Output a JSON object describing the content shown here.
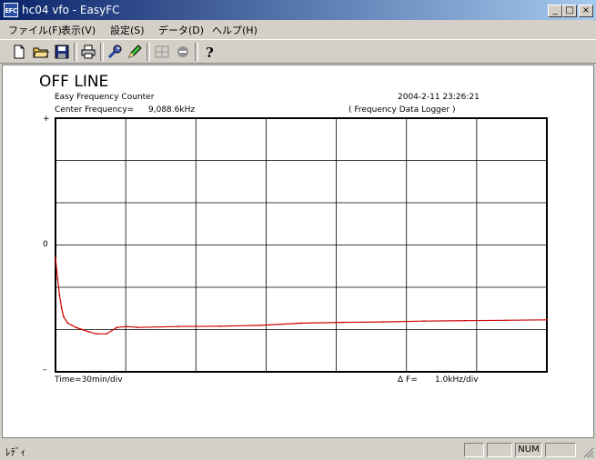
{
  "window": {
    "app_icon_text": "EFC",
    "title": "hc04 vfo - EasyFC",
    "minimize": "_",
    "maximize": "□",
    "close": "×"
  },
  "menu": [
    "ファイル(F)",
    "表示(V)",
    "設定(S)",
    "データ(D)",
    "ヘルプ(H)"
  ],
  "toolbar": {
    "icons": [
      "new-file-icon",
      "open-folder-icon",
      "save-disk-icon",
      "print-icon",
      "wrench-icon",
      "pencil-icon",
      "grid-icon",
      "stop-icon",
      "help-icon"
    ]
  },
  "display": {
    "status_title": "OFF LINE",
    "app_name": "Easy Frequency Counter",
    "timestamp": "2004-2-11  23:26:21",
    "center_freq_label": "Center Frequency=",
    "center_freq_value": "9,088.6kHz",
    "mode_label": "( Frequency Data Logger )",
    "y_top": "+",
    "y_mid": "0",
    "y_bottom": "–",
    "time_scale": "Time=30min/div",
    "delta_label": "Δ F=",
    "delta_value": "1.0kHz/div"
  },
  "chart_data": {
    "type": "line",
    "x_unit": "min",
    "y_unit": "kHz (offset from center)",
    "xlim": [
      0,
      240
    ],
    "ylim": [
      -3,
      3
    ],
    "grid": true,
    "series": [
      {
        "color": "#cc0000",
        "x": [
          0,
          1,
          2,
          3,
          4,
          6,
          8,
          10,
          13,
          16,
          20,
          25,
          30,
          35,
          40,
          60,
          80,
          100,
          120,
          140,
          160,
          180,
          200,
          220,
          240
        ],
        "y": [
          -0.3,
          -0.8,
          -1.2,
          -1.5,
          -1.7,
          -1.85,
          -1.9,
          -1.95,
          -2.0,
          -2.05,
          -2.1,
          -2.1,
          -1.95,
          -1.93,
          -1.95,
          -1.93,
          -1.92,
          -1.9,
          -1.85,
          -1.83,
          -1.82,
          -1.8,
          -1.79,
          -1.78,
          -1.77
        ]
      }
    ]
  },
  "statusbar": {
    "text": "ﾚﾃﾞｨ",
    "num": "NUM"
  }
}
